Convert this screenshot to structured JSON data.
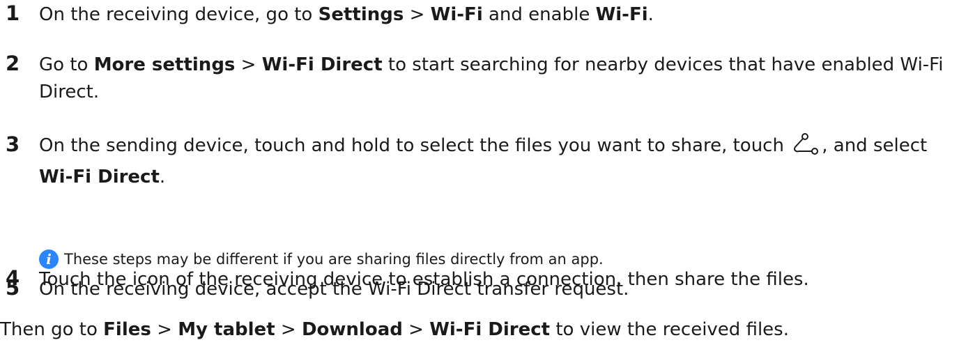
{
  "steps": [
    {
      "num": "1",
      "t1": "On the receiving device, go to ",
      "b1": "Settings",
      "t2": " > ",
      "b2": "Wi-Fi",
      "t3": " and enable ",
      "b3": "Wi-Fi",
      "t4": "."
    },
    {
      "num": "2",
      "t1": "Go to ",
      "b1": "More settings",
      "t2": " > ",
      "b2": "Wi-Fi Direct",
      "t3": " to start searching for nearby devices that have enabled Wi-Fi Direct."
    },
    {
      "num": "3",
      "t1": "On the sending device, touch and hold to select the files you want to share, touch ",
      "icon": "share-icon",
      "t2": ", and select ",
      "b1": "Wi-Fi Direct",
      "t3": "."
    },
    {
      "num": "4",
      "t1": "Touch the icon of the receiving device to establish a connection, then share the files."
    },
    {
      "num": "5",
      "t1": "On the receiving device, accept the Wi-Fi Direct transfer request."
    }
  ],
  "note": {
    "icon": "info-icon",
    "text": "These steps may be different if you are sharing files directly from an app."
  },
  "final": {
    "t1": "Then go to ",
    "b1": "Files",
    "t2": " > ",
    "b2": "My tablet",
    "t3": " > ",
    "b3": "Download",
    "t4": " > ",
    "b4": "Wi-Fi Direct",
    "t5": " to view the received files."
  },
  "colors": {
    "text": "#1a1a1a",
    "info_icon": "#2a86ff"
  }
}
